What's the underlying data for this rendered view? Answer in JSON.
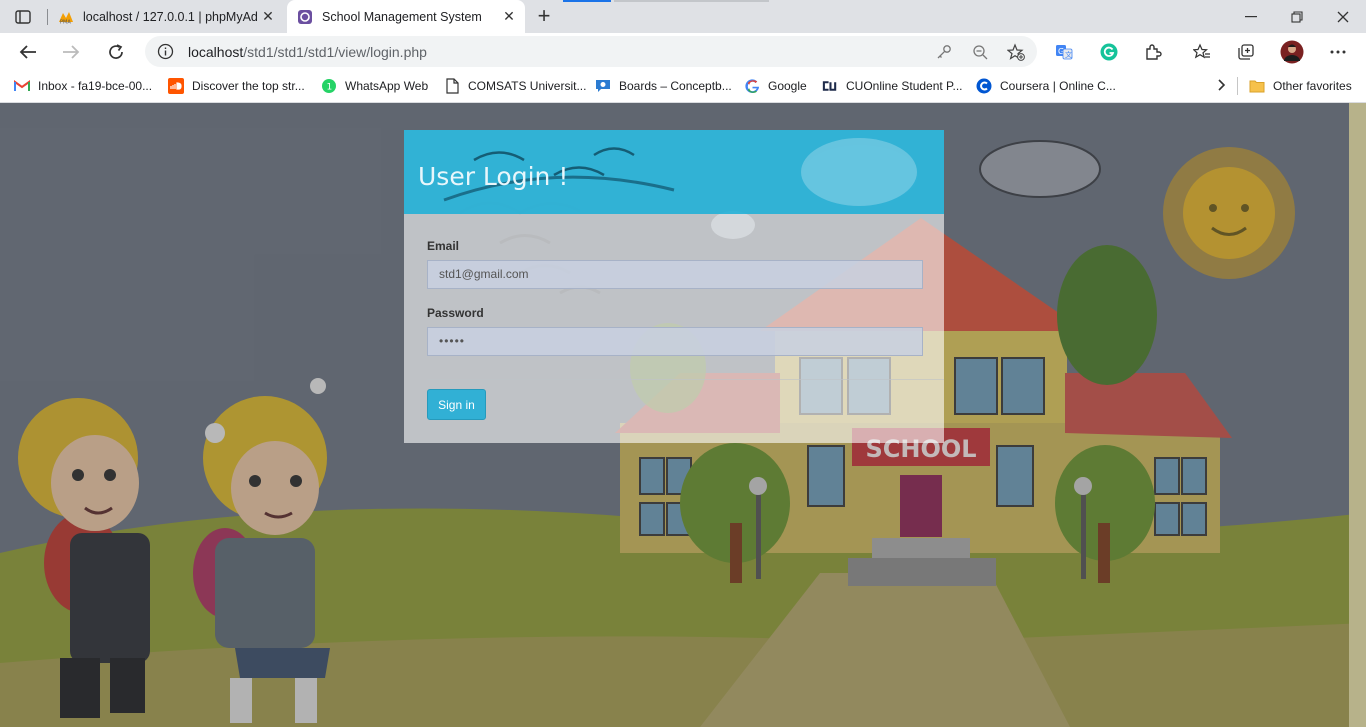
{
  "browser": {
    "tabs": [
      {
        "title": "localhost / 127.0.0.1 | phpMyAdmin",
        "favicon": "phpmyadmin-icon",
        "active": false
      },
      {
        "title": "School Management System",
        "favicon": "page-icon",
        "active": true
      }
    ],
    "url": {
      "host": "localhost",
      "path": "/std1/std1/std1/view/login.php"
    },
    "bookmarks": [
      {
        "label": "Inbox - fa19-bce-00...",
        "icon": "gmail-icon"
      },
      {
        "label": "Discover the top str...",
        "icon": "soundcloud-icon"
      },
      {
        "label": "WhatsApp Web",
        "icon": "whatsapp-icon"
      },
      {
        "label": "COMSATS Universit...",
        "icon": "page-icon"
      },
      {
        "label": "Boards – Conceptb...",
        "icon": "conceptboard-icon"
      },
      {
        "label": "Google",
        "icon": "google-icon"
      },
      {
        "label": "CUOnline Student P...",
        "icon": "cu-icon"
      },
      {
        "label": "Coursera | Online C...",
        "icon": "coursera-icon"
      }
    ],
    "other_favorites": "Other favorites"
  },
  "login": {
    "heading": "User Login !",
    "email_label": "Email",
    "email_value": "std1@gmail.com",
    "password_label": "Password",
    "password_value": "•••••",
    "signin_label": "Sign in"
  },
  "scene": {
    "school_sign": "SCHOOL"
  },
  "colors": {
    "heading_bg": "#1eafd7",
    "signin_bg": "#31b0d5",
    "sky": "#6b7481",
    "grass": "#8e9a36"
  }
}
